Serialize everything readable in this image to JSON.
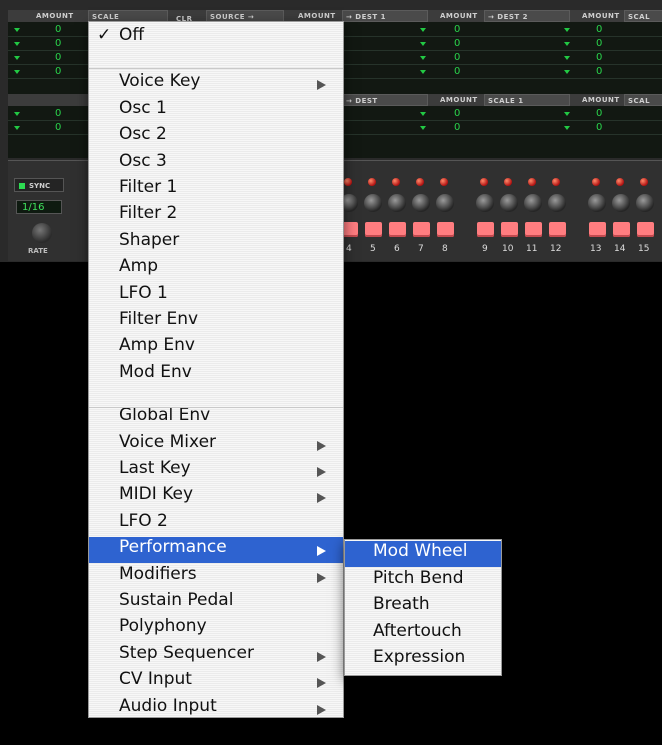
{
  "matrix": {
    "header_top": [
      "AMOUNT",
      "SCALE",
      "CLR",
      "SOURCE →",
      "AMOUNT",
      "→ DEST 1",
      "AMOUNT",
      "→ DEST 2",
      "AMOUNT",
      "SCAL"
    ],
    "header_mid": [
      "→ DEST",
      "AMOUNT",
      "SCALE 1",
      "AMOUNT",
      "SCAL"
    ],
    "zero": "0"
  },
  "lfo": {
    "sync_label": "SYNC",
    "rate_value": "1/16",
    "rate_label": "RATE"
  },
  "step_numbers": [
    "4",
    "5",
    "6",
    "7",
    "8",
    "9",
    "10",
    "11",
    "12",
    "13",
    "14",
    "15"
  ],
  "menu": {
    "selected_item": "Performance",
    "items": [
      {
        "label": "Off",
        "checked": true
      },
      {
        "label": "Voice Key",
        "submenu": true
      },
      {
        "label": "Osc 1"
      },
      {
        "label": "Osc 2"
      },
      {
        "label": "Osc 3"
      },
      {
        "label": "Filter 1"
      },
      {
        "label": "Filter 2"
      },
      {
        "label": "Shaper"
      },
      {
        "label": "Amp"
      },
      {
        "label": "LFO 1"
      },
      {
        "label": "Filter Env"
      },
      {
        "label": "Amp Env"
      },
      {
        "label": "Mod Env"
      },
      {
        "label": "Global Env"
      },
      {
        "label": "Voice Mixer",
        "submenu": true
      },
      {
        "label": "Last Key",
        "submenu": true
      },
      {
        "label": "MIDI Key",
        "submenu": true
      },
      {
        "label": "LFO 2"
      },
      {
        "label": "Performance",
        "submenu": true,
        "selected": true
      },
      {
        "label": "Modifiers",
        "submenu": true
      },
      {
        "label": "Sustain Pedal"
      },
      {
        "label": "Polyphony"
      },
      {
        "label": "Step Sequencer",
        "submenu": true
      },
      {
        "label": "CV Input",
        "submenu": true
      },
      {
        "label": "Audio Input",
        "submenu": true
      }
    ],
    "check_glyph": "✓"
  },
  "submenu": {
    "items": [
      {
        "label": "Mod Wheel",
        "selected": true
      },
      {
        "label": "Pitch Bend"
      },
      {
        "label": "Breath"
      },
      {
        "label": "Aftertouch"
      },
      {
        "label": "Expression"
      }
    ]
  },
  "colors": {
    "selection": "#2e63d0",
    "matrix_text": "#24d24a",
    "pad": "#ff7d80"
  }
}
